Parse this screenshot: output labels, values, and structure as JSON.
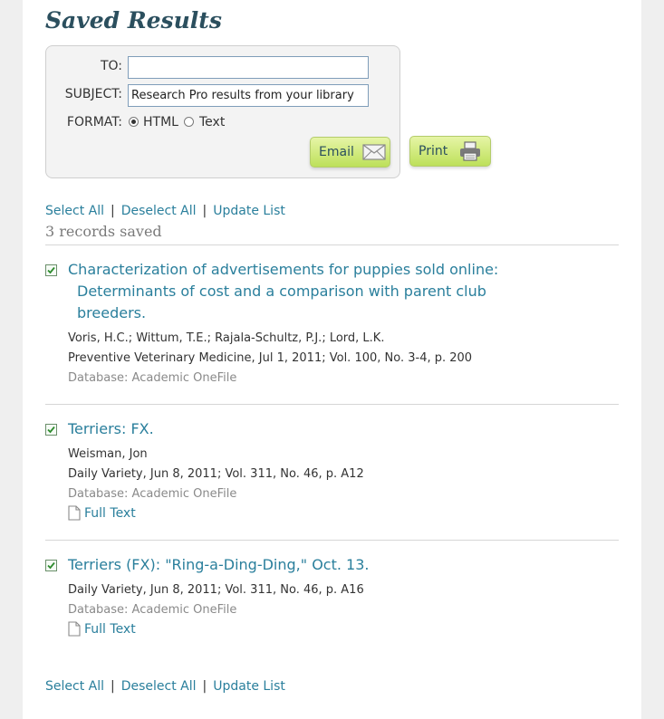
{
  "page_title": "Saved Results",
  "email_form": {
    "to_label": "TO:",
    "to_value": "",
    "subject_label": "SUBJECT:",
    "subject_value": "Research Pro results from your library",
    "format_label": "FORMAT:",
    "format_options": [
      {
        "label": "HTML",
        "selected": true
      },
      {
        "label": "Text",
        "selected": false
      }
    ],
    "email_button": "Email",
    "email_icon": "envelope-icon",
    "print_button": "Print",
    "print_icon": "printer-icon"
  },
  "actions": {
    "select_all": "Select All",
    "deselect_all": "Deselect All",
    "update_list": "Update List",
    "separator": "|"
  },
  "records_saved": "3 records saved",
  "records": [
    {
      "checked": true,
      "title_line1": "Characterization of advertisements for puppies sold online:",
      "title_line2": "Determinants of cost and a comparison with parent club",
      "title_line3": "breeders.",
      "authors": "Voris, H.C.;  Wittum, T.E.;  Rajala-Schultz, P.J.;  Lord, L.K.",
      "source": "Preventive Veterinary Medicine, Jul 1, 2011; Vol. 100, No. 3-4, p. 200",
      "database": "Database: Academic OneFile"
    },
    {
      "checked": true,
      "title": "Terriers: FX.",
      "authors": "Weisman, Jon",
      "source": "Daily Variety, Jun 8, 2011; Vol. 311, No. 46, p. A12",
      "database": "Database: Academic OneFile",
      "full_text": "Full Text"
    },
    {
      "checked": true,
      "title": "Terriers (FX): \"Ring-a-Ding-Ding,\" Oct. 13.",
      "source": "Daily Variety, Jun 8, 2011; Vol. 311, No. 46, p. A16",
      "database": "Database: Academic OneFile",
      "full_text": "Full Text"
    }
  ],
  "colors": {
    "title": "#2b4f5e",
    "link": "#2a7f9c",
    "muted": "#8a8a8a",
    "button_green": "#bde05a",
    "check_green": "#2e8b2e"
  }
}
